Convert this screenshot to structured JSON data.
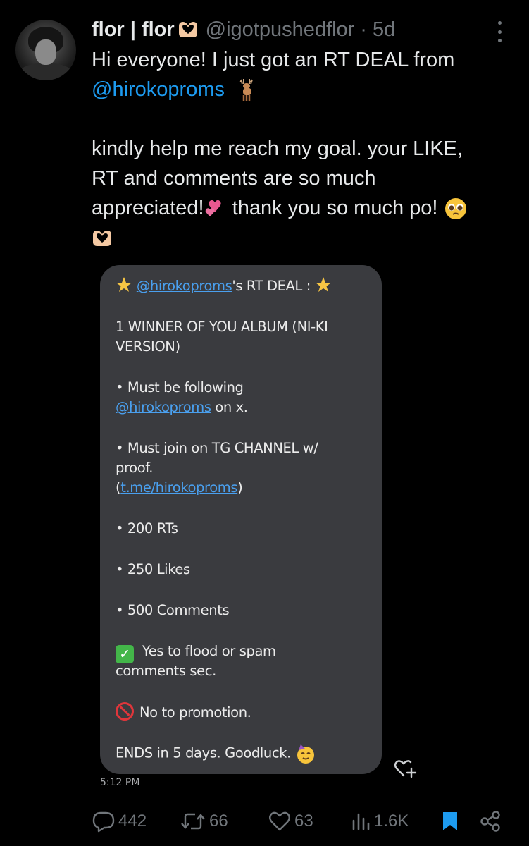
{
  "post": {
    "display_name": "flor | flor",
    "handle": "@igotpushedflor",
    "separator": "·",
    "time_ago": "5d",
    "text": {
      "line1": "Hi everyone! I just got an RT DEAL from",
      "mention": "@hirokoproms",
      "line3": "kindly help me reach my goal. your LIKE,",
      "line4": "RT and comments are so much",
      "line5a": "appreciated!",
      "line5b": " thank you so much po! "
    }
  },
  "media": {
    "title_handle": "@hirokoproms",
    "title_rest": "'s RT DEAL : ",
    "prize_line1": "1 WINNER OF YOU ALBUM (NI-KI",
    "prize_line2": "VERSION)",
    "rule1_line1": "• Must be following",
    "rule1_link": "@hirokoproms",
    "rule1_rest": " on x.",
    "rule2_line1": "• Must join on TG CHANNEL w/",
    "rule2_line2": "proof.",
    "rule2_open": "(",
    "rule2_link": "t.me/hirokoproms",
    "rule2_close": ")",
    "rts": "• 200 RTs",
    "likes": "• 250 Likes",
    "comments": "• 500 Comments",
    "check_symbol": "✓",
    "yes_line1": " Yes to flood or spam",
    "yes_line2": "comments sec.",
    "no_promo": "No to promotion.",
    "ends": "ENDS in 5 days. Goodluck. ",
    "timestamp": "5:12 PM"
  },
  "actions": {
    "replies": "442",
    "reposts": "66",
    "likes": "63",
    "views": "1.6K"
  },
  "colors": {
    "accent": "#1d9bf0",
    "muted": "#71767b",
    "bubble": "#3a3b3f"
  }
}
